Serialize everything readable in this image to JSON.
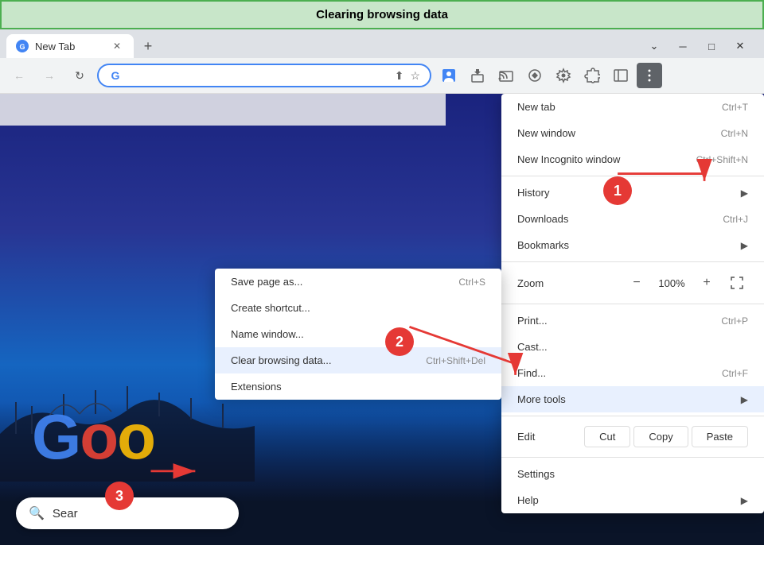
{
  "titleBar": {
    "label": "Clearing browsing data"
  },
  "browser": {
    "tab": {
      "label": "New Tab",
      "favicon": "●"
    },
    "newTabBtn": "+",
    "windowControls": {
      "minimize": "─",
      "maximize": "□",
      "close": "✕",
      "dropdown": "⌄"
    },
    "toolbar": {
      "back": "←",
      "forward": "→",
      "reload": "↻",
      "addressBar": {
        "googleG": "G",
        "value": ""
      },
      "icons": [
        "⬆",
        "☆",
        "⬛",
        "🔌",
        "🔧",
        "⬛",
        "🔲"
      ]
    }
  },
  "mainMenu": {
    "items": [
      {
        "label": "New tab",
        "shortcut": "Ctrl+T",
        "hasArrow": false
      },
      {
        "label": "New window",
        "shortcut": "Ctrl+N",
        "hasArrow": false,
        "hasCircle": true
      },
      {
        "label": "New Incognito window",
        "shortcut": "Ctrl+Shift+N",
        "hasArrow": false
      },
      {
        "separator": true
      },
      {
        "label": "History",
        "shortcut": "",
        "hasArrow": true
      },
      {
        "label": "Downloads",
        "shortcut": "Ctrl+J",
        "hasArrow": false
      },
      {
        "label": "Bookmarks",
        "shortcut": "",
        "hasArrow": true
      },
      {
        "separator": true
      },
      {
        "label": "Zoom",
        "isZoom": true,
        "zoomMinus": "−",
        "zoomValue": "100%",
        "zoomPlus": "+",
        "zoomFullscreen": "⤢"
      },
      {
        "separator": true
      },
      {
        "label": "Print...",
        "shortcut": "Ctrl+P",
        "hasArrow": false
      },
      {
        "label": "Cast...",
        "shortcut": "",
        "hasArrow": false
      },
      {
        "label": "Find...",
        "shortcut": "Ctrl+F",
        "hasArrow": false
      },
      {
        "label": "More tools",
        "shortcut": "",
        "hasArrow": true,
        "highlighted": true
      },
      {
        "separator": true
      },
      {
        "label": "Edit",
        "isEdit": true,
        "cutLabel": "Cut",
        "copyLabel": "Copy",
        "pasteLabel": "Paste"
      },
      {
        "separator": true
      },
      {
        "label": "Settings",
        "shortcut": "",
        "hasArrow": false
      },
      {
        "label": "Help",
        "shortcut": "",
        "hasArrow": true
      }
    ]
  },
  "subMenu": {
    "items": [
      {
        "label": "Save page as...",
        "shortcut": "Ctrl+S"
      },
      {
        "label": "Create shortcut...",
        "shortcut": ""
      },
      {
        "label": "Name window...",
        "shortcut": ""
      },
      {
        "label": "Clear browsing data...",
        "shortcut": "Ctrl+Shift+Del",
        "highlighted": true
      },
      {
        "label": "Extensions",
        "shortcut": ""
      }
    ]
  },
  "searchBar": {
    "placeholder": "Sear"
  },
  "steps": {
    "step1": "1",
    "step2": "2",
    "step3": "3"
  }
}
